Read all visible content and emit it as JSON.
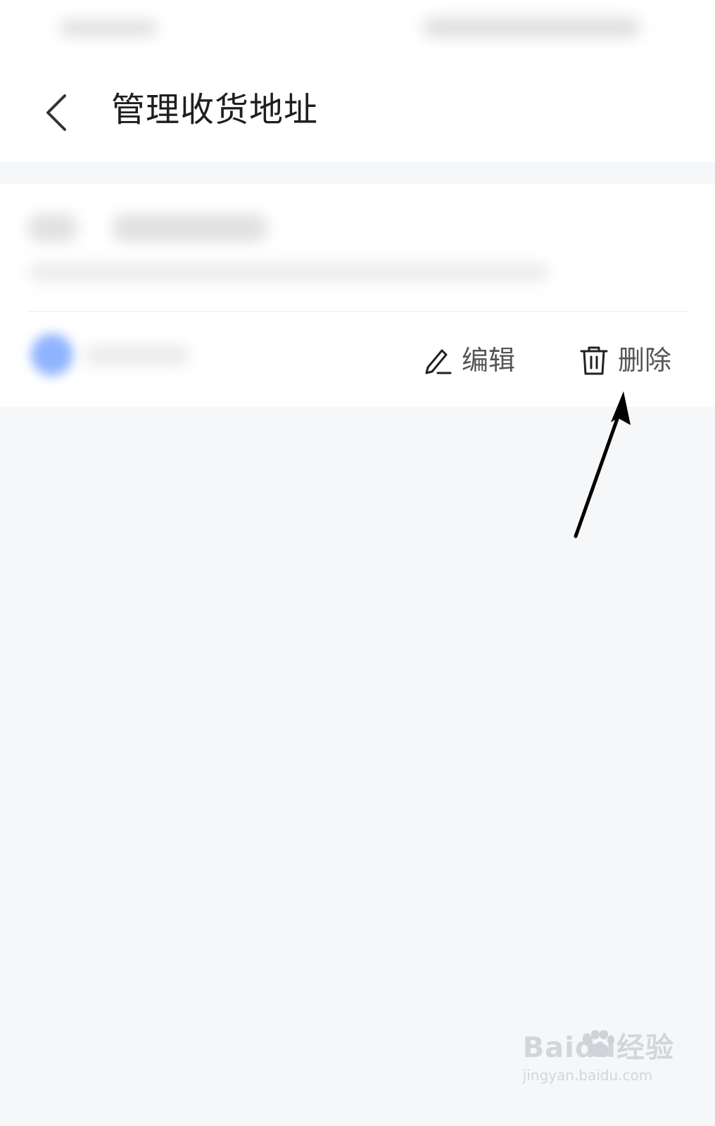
{
  "header": {
    "title": "管理收货地址"
  },
  "address_card": {
    "actions": {
      "edit_label": "编辑",
      "delete_label": "删除"
    }
  },
  "icons": {
    "back": "chevron-left-icon",
    "edit": "pencil-icon",
    "delete": "trash-icon"
  },
  "watermark": {
    "brand": "Baidu经验",
    "url": "jingyan.baidu.com"
  },
  "colors": {
    "background": "#f6f7f9",
    "surface": "#ffffff",
    "accent_blue": "#8fb4ff",
    "text_primary": "#1f1f1f",
    "text_secondary": "#555555"
  }
}
